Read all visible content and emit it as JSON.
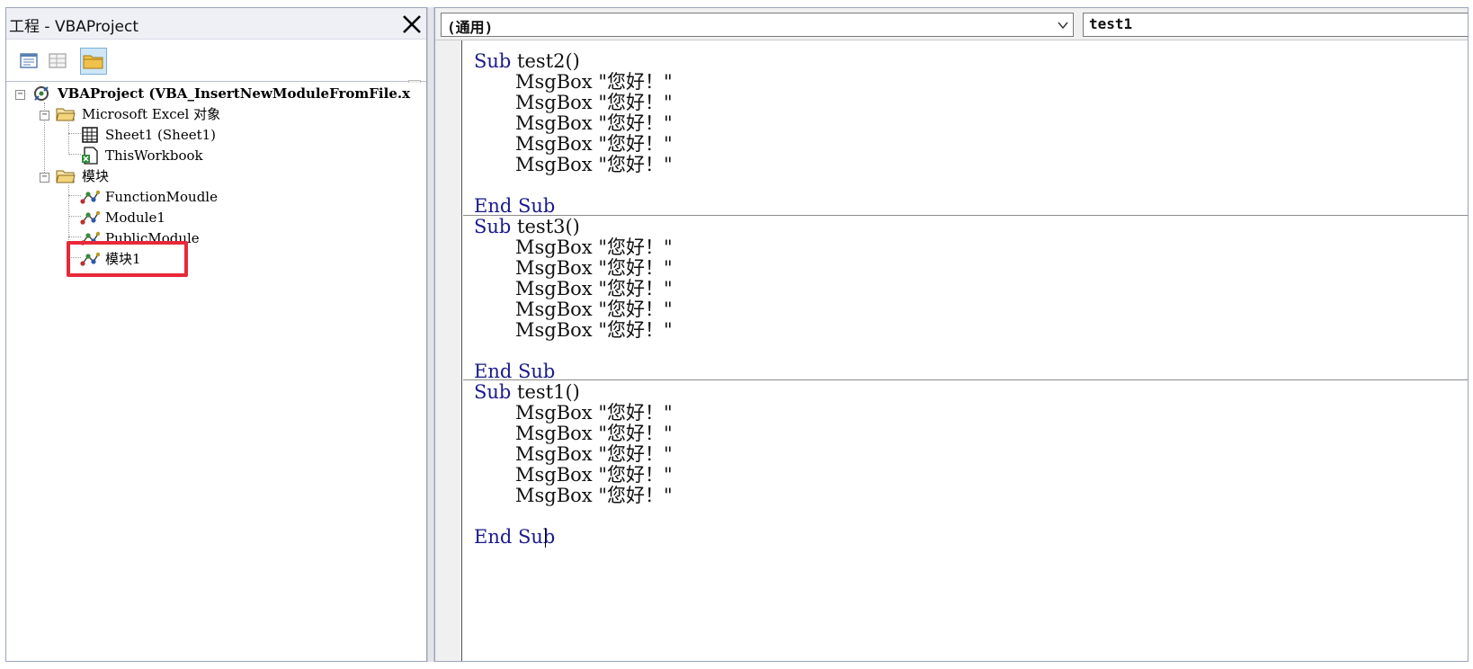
{
  "project_explorer": {
    "title": "工程 - VBAProject",
    "close_icon": "close-icon",
    "toolbar": {
      "view_code_icon": "view-code-icon",
      "view_object_icon": "view-object-icon",
      "toggle_folders_icon": "folder-icon"
    },
    "tree": {
      "root": "VBAProject (VBA_InsertNewModuleFromFile.x",
      "excel_objects_folder": "Microsoft Excel 对象",
      "sheet1": "Sheet1 (Sheet1)",
      "this_workbook": "ThisWorkbook",
      "modules_folder": "模块",
      "modules": [
        "FunctionMoudle",
        "Module1",
        "PublicModule",
        "模块1"
      ]
    },
    "highlight_color": "#e8283a"
  },
  "code_window": {
    "object_combo": "(通用)",
    "procedure_combo": "test1",
    "keyword_color": "#1a1a8c",
    "procedures": [
      {
        "sub_kw": "Sub",
        "sub_name": "test2()",
        "body": [
          "MsgBox \"您好！\"",
          "MsgBox \"您好！\"",
          "MsgBox \"您好！\"",
          "MsgBox \"您好！\"",
          "MsgBox \"您好！\""
        ],
        "end_kw": "End Sub"
      },
      {
        "sub_kw": "Sub",
        "sub_name": "test3()",
        "body": [
          "MsgBox \"您好！\"",
          "MsgBox \"您好！\"",
          "MsgBox \"您好！\"",
          "MsgBox \"您好！\"",
          "MsgBox \"您好！\""
        ],
        "end_kw": "End Sub"
      },
      {
        "sub_kw": "Sub",
        "sub_name": "test1()",
        "body": [
          "MsgBox \"您好！\"",
          "MsgBox \"您好！\"",
          "MsgBox \"您好！\"",
          "MsgBox \"您好！\"",
          "MsgBox \"您好！\""
        ],
        "end_kw": "End Sub"
      }
    ]
  }
}
